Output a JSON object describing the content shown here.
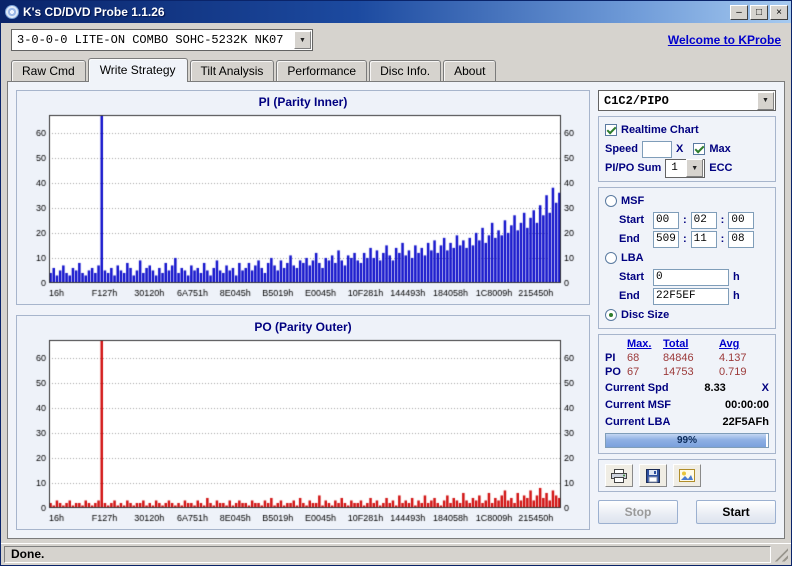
{
  "titlebar": {
    "title": "K's CD/DVD Probe 1.1.26",
    "minimize_glyph": "–",
    "maximize_glyph": "□",
    "close_glyph": "×"
  },
  "icons": {
    "dropdown_arrow": "▼"
  },
  "drive_selector": {
    "value": "3-0-0-0 LITE-ON COMBO SOHC-5232K NK07"
  },
  "link": {
    "text": "Welcome to KProbe"
  },
  "tabs": {
    "active_index": 1,
    "items": [
      {
        "label": "Raw Cmd"
      },
      {
        "label": "Write Strategy"
      },
      {
        "label": "Tilt Analysis"
      },
      {
        "label": "Performance"
      },
      {
        "label": "Disc Info."
      },
      {
        "label": "About"
      }
    ]
  },
  "controls": {
    "mode_select": {
      "value": "C1C2/PIPO"
    },
    "realtime_chart": {
      "label": "Realtime Chart",
      "checked": true
    },
    "speed": {
      "label": "Speed",
      "value": "",
      "x_label": "X",
      "max_label": "Max",
      "max_checked": true
    },
    "pipo_sum": {
      "label": "PI/PO Sum",
      "value": "1",
      "ecc_label": "ECC"
    },
    "msf": {
      "label": "MSF",
      "start_label": "Start",
      "end_label": "End",
      "sep": ":",
      "start": [
        "00",
        "02",
        "00"
      ],
      "end": [
        "509",
        "11",
        "08"
      ]
    },
    "lba": {
      "label": "LBA",
      "start_label": "Start",
      "end_label": "End",
      "start": "0",
      "end": "22F5EF",
      "unit": "h"
    },
    "disc_size": {
      "label": "Disc Size",
      "selected": true
    }
  },
  "stats": {
    "col_headers": [
      "Max.",
      "Total",
      "Avg"
    ],
    "pi": {
      "label": "PI",
      "max": "68",
      "total": "84846",
      "avg": "4.137"
    },
    "po": {
      "label": "PO",
      "max": "67",
      "total": "14753",
      "avg": "0.719"
    },
    "current_spd": {
      "label": "Current Spd",
      "value": "8.33",
      "suffix": "X"
    },
    "current_msf": {
      "label": "Current MSF",
      "value": "00:00:00"
    },
    "current_lba": {
      "label": "Current LBA",
      "value": "22F5AFh"
    },
    "progress": {
      "text": "99%",
      "percent": 99
    }
  },
  "buttons": {
    "stop": "Stop",
    "start": "Start"
  },
  "statusbar": {
    "text": "Done."
  },
  "chart_data": [
    {
      "type": "bar",
      "title": "PI (Parity Inner)",
      "color": "#1414cc",
      "ylim": [
        0,
        67
      ],
      "yticks": [
        0,
        10,
        20,
        30,
        40,
        50,
        60
      ],
      "grid": true,
      "xticklabels": [
        "16h",
        "F127h",
        "30120h",
        "6A751h",
        "8E045h",
        "B5019h",
        "E0045h",
        "10F281h",
        "144493h",
        "184058h",
        "1C8009h",
        "215450h"
      ],
      "values": [
        4,
        6,
        3,
        5,
        7,
        4,
        3,
        6,
        5,
        8,
        4,
        3,
        5,
        6,
        4,
        7,
        68,
        5,
        4,
        6,
        3,
        7,
        5,
        4,
        8,
        6,
        3,
        5,
        9,
        4,
        6,
        7,
        5,
        3,
        6,
        4,
        8,
        5,
        7,
        10,
        4,
        6,
        5,
        3,
        7,
        5,
        6,
        4,
        8,
        5,
        3,
        6,
        9,
        5,
        4,
        7,
        5,
        6,
        3,
        8,
        5,
        6,
        8,
        5,
        7,
        9,
        6,
        4,
        8,
        10,
        7,
        5,
        9,
        6,
        8,
        11,
        7,
        6,
        9,
        8,
        10,
        7,
        9,
        12,
        8,
        6,
        10,
        9,
        11,
        8,
        13,
        9,
        7,
        11,
        10,
        12,
        9,
        8,
        12,
        10,
        14,
        10,
        13,
        9,
        12,
        15,
        11,
        9,
        14,
        12,
        16,
        11,
        13,
        10,
        15,
        12,
        14,
        11,
        16,
        13,
        17,
        12,
        15,
        18,
        13,
        16,
        14,
        19,
        15,
        17,
        14,
        18,
        15,
        20,
        17,
        22,
        16,
        19,
        24,
        18,
        21,
        19,
        25,
        20,
        23,
        27,
        21,
        24,
        28,
        22,
        26,
        29,
        24,
        31,
        27,
        35,
        28,
        38,
        32,
        36
      ]
    },
    {
      "type": "bar",
      "title": "PO (Parity Outer)",
      "color": "#d21414",
      "ylim": [
        0,
        67
      ],
      "yticks": [
        0,
        10,
        20,
        30,
        40,
        50,
        60
      ],
      "grid": true,
      "xticklabels": [
        "16h",
        "F127h",
        "30120h",
        "6A751h",
        "8E045h",
        "B5019h",
        "E0045h",
        "10F281h",
        "144493h",
        "184058h",
        "1C8009h",
        "215450h"
      ],
      "values": [
        2,
        1,
        3,
        2,
        1,
        2,
        3,
        1,
        2,
        2,
        1,
        3,
        2,
        1,
        2,
        3,
        67,
        2,
        1,
        2,
        3,
        1,
        2,
        1,
        3,
        2,
        1,
        2,
        2,
        3,
        1,
        2,
        1,
        3,
        2,
        1,
        2,
        3,
        2,
        1,
        2,
        1,
        3,
        2,
        2,
        1,
        3,
        2,
        1,
        4,
        2,
        1,
        3,
        2,
        2,
        1,
        3,
        1,
        2,
        3,
        2,
        2,
        1,
        3,
        2,
        2,
        1,
        3,
        2,
        4,
        1,
        2,
        3,
        1,
        2,
        2,
        3,
        1,
        4,
        2,
        1,
        3,
        2,
        2,
        5,
        1,
        3,
        2,
        1,
        3,
        2,
        4,
        2,
        1,
        3,
        2,
        2,
        3,
        1,
        2,
        4,
        2,
        3,
        1,
        2,
        4,
        2,
        3,
        1,
        5,
        2,
        3,
        2,
        4,
        1,
        3,
        2,
        5,
        2,
        3,
        4,
        2,
        1,
        3,
        5,
        2,
        4,
        3,
        2,
        6,
        3,
        2,
        4,
        3,
        5,
        2,
        3,
        6,
        2,
        4,
        3,
        5,
        7,
        3,
        4,
        2,
        6,
        3,
        5,
        4,
        7,
        3,
        5,
        8,
        4,
        6,
        3,
        7,
        5,
        4
      ]
    }
  ]
}
